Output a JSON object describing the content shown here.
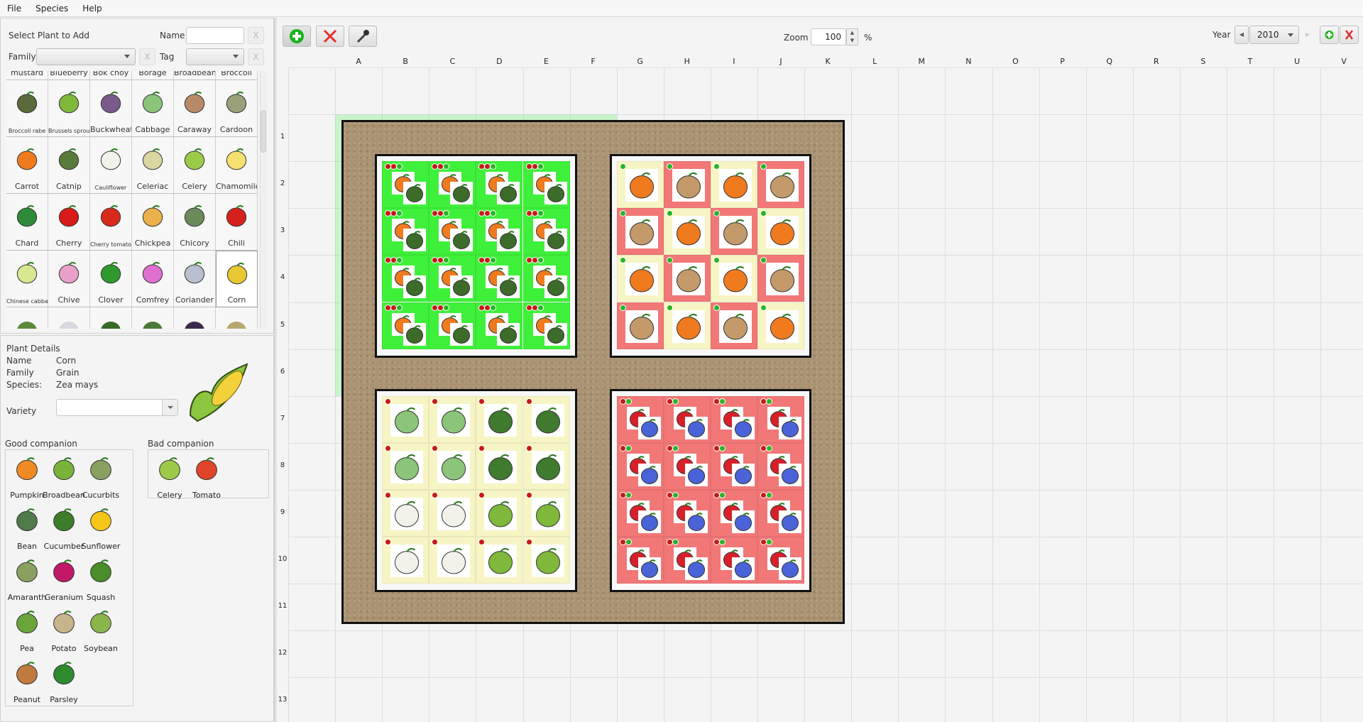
{
  "menu": [
    "File",
    "Species",
    "Help"
  ],
  "select_panel": {
    "title": "Select Plant to Add",
    "name_label": "Name",
    "name_value": "",
    "family_label": "Family",
    "family_value": "",
    "tag_label": "Tag",
    "tag_value": "",
    "clear_label": "X"
  },
  "palette": [
    "mustard",
    "Blueberry",
    "Bok choy",
    "Borage",
    "Broadbean",
    "Broccoli",
    "Broccoli rabe",
    "Brussels sprouts",
    "Buckwheat",
    "Cabbage",
    "Caraway",
    "Cardoon",
    "Carrot",
    "Catnip",
    "Cauliflower",
    "Celeriac",
    "Celery",
    "Chamomile",
    "Chard",
    "Cherry",
    "Cherry tomato",
    "Chickpea",
    "Chicory",
    "Chili",
    "Chinese cabbage",
    "Chive",
    "Clover",
    "Comfrey",
    "Coriander",
    "Corn",
    "",
    "",
    "",
    "",
    "",
    ""
  ],
  "selected_plant": "Corn",
  "details": {
    "title": "Plant Details",
    "name_label": "Name",
    "name": "Corn",
    "family_label": "Family",
    "family": "Grain",
    "species_label": "Species:",
    "species": "Zea mays",
    "variety_label": "Variety",
    "variety": ""
  },
  "good_companion": {
    "label": "Good companion",
    "items": [
      "Pumpkin",
      "Broadbean",
      "Cucurbits",
      "Bean",
      "Cucumber",
      "Sunflower",
      "Amaranth",
      "Geranium",
      "Squash",
      "Pea",
      "Potato",
      "Soybean",
      "Peanut",
      "Parsley"
    ]
  },
  "bad_companion": {
    "label": "Bad companion",
    "items": [
      "Celery",
      "Tomato"
    ]
  },
  "toolbar": {
    "add_icon": "green-plus-icon",
    "delete_icon": "red-x-icon",
    "picker_icon": "eyedropper-icon",
    "zoom_label": "Zoom",
    "zoom_value": "100",
    "zoom_unit": "%",
    "year_label": "Year",
    "year_value": "2010"
  },
  "columns": [
    "A",
    "B",
    "C",
    "D",
    "E",
    "F",
    "G",
    "H",
    "I",
    "J",
    "K",
    "L",
    "M",
    "N",
    "O",
    "P",
    "Q",
    "R",
    "S",
    "T",
    "U",
    "V"
  ],
  "rows": [
    "1",
    "2",
    "3",
    "4",
    "5",
    "6",
    "7",
    "8",
    "9",
    "10",
    "11",
    "12",
    "13"
  ],
  "colors": {
    "good": "#3ff03a",
    "neutral": "#f7f5c4",
    "bad": "#f27777",
    "soil": "#a99372"
  },
  "beds": [
    {
      "status": "good",
      "cells": [
        [
          [
            "Carrot",
            "Dill"
          ],
          [
            "Carrot",
            "Dill"
          ],
          [
            "Carrot",
            "Dill"
          ],
          [
            "Carrot",
            "Dill"
          ]
        ],
        [
          [
            "Carrot",
            "Dill"
          ],
          [
            "Carrot",
            "Dill"
          ],
          [
            "Carrot",
            "Dill"
          ],
          [
            "Carrot",
            "Dill"
          ]
        ],
        [
          [
            "Carrot",
            "Dill"
          ],
          [
            "Carrot",
            "Dill"
          ],
          [
            "Carrot",
            "Dill"
          ],
          [
            "Carrot",
            "Dill"
          ]
        ],
        [
          [
            "Carrot",
            "Dill"
          ],
          [
            "Carrot",
            "Dill"
          ],
          [
            "Carrot",
            "Dill"
          ],
          [
            "Carrot",
            "Dill"
          ]
        ]
      ]
    },
    {
      "status": "mixed",
      "cells": [
        [
          [
            "Carrot"
          ],
          [
            "Onion"
          ],
          [
            "Carrot"
          ],
          [
            "Onion"
          ]
        ],
        [
          [
            "Onion"
          ],
          [
            "Carrot"
          ],
          [
            "Onion"
          ],
          [
            "Carrot"
          ]
        ],
        [
          [
            "Carrot"
          ],
          [
            "Onion"
          ],
          [
            "Carrot"
          ],
          [
            "Onion"
          ]
        ],
        [
          [
            "Onion"
          ],
          [
            "Carrot"
          ],
          [
            "Onion"
          ],
          [
            "Carrot"
          ]
        ]
      ]
    },
    {
      "status": "neutral",
      "cells": [
        [
          [
            "Cabbage"
          ],
          [
            "Cabbage"
          ],
          [
            "Broccoli"
          ],
          [
            "Broccoli"
          ]
        ],
        [
          [
            "Cabbage"
          ],
          [
            "Cabbage"
          ],
          [
            "Broccoli"
          ],
          [
            "Broccoli"
          ]
        ],
        [
          [
            "Cauliflower"
          ],
          [
            "Cauliflower"
          ],
          [
            "Brussels sprouts"
          ],
          [
            "Brussels sprouts"
          ]
        ],
        [
          [
            "Cauliflower"
          ],
          [
            "Cauliflower"
          ],
          [
            "Brussels sprouts"
          ],
          [
            "Brussels sprouts"
          ]
        ]
      ]
    },
    {
      "status": "bad",
      "cells": [
        [
          [
            "Strawberry",
            "Borage"
          ],
          [
            "Strawberry",
            "Borage"
          ],
          [
            "Strawberry",
            "Borage"
          ],
          [
            "Strawberry",
            "Borage"
          ]
        ],
        [
          [
            "Strawberry",
            "Borage"
          ],
          [
            "Strawberry",
            "Borage"
          ],
          [
            "Strawberry",
            "Borage"
          ],
          [
            "Strawberry",
            "Borage"
          ]
        ],
        [
          [
            "Strawberry",
            "Borage"
          ],
          [
            "Strawberry",
            "Borage"
          ],
          [
            "Strawberry",
            "Borage"
          ],
          [
            "Strawberry",
            "Borage"
          ]
        ],
        [
          [
            "Strawberry",
            "Borage"
          ],
          [
            "Strawberry",
            "Borage"
          ],
          [
            "Strawberry",
            "Borage"
          ],
          [
            "Strawberry",
            "Borage"
          ]
        ]
      ]
    }
  ]
}
